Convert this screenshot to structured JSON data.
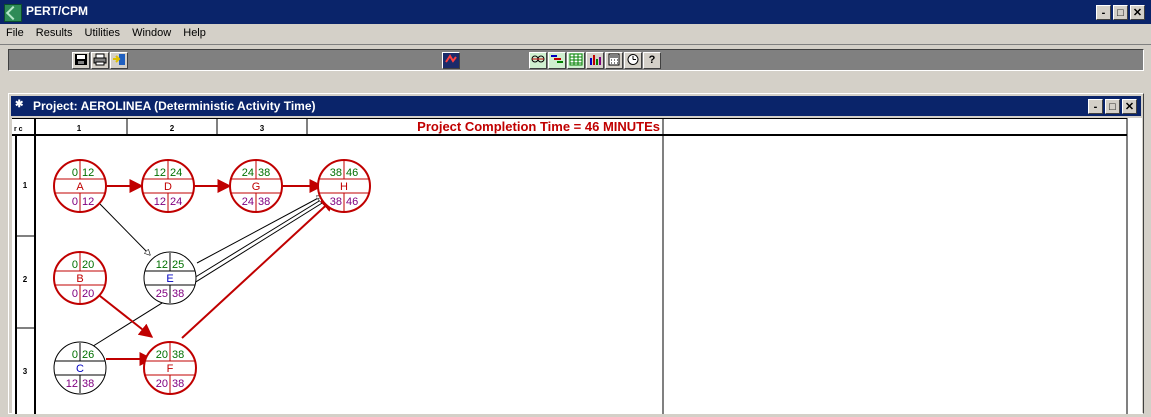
{
  "app": {
    "title": "PERT/CPM"
  },
  "window_controls": {
    "minimize": "-",
    "maximize": "□",
    "close": "✕"
  },
  "menu": [
    "File",
    "Results",
    "Utilities",
    "Window",
    "Help"
  ],
  "toolbar": {
    "icons": [
      "save-icon",
      "print-icon",
      "exit-icon",
      "solve-icon",
      "network-icon",
      "gantt-icon",
      "table-icon",
      "bar-chart-icon",
      "calculator-icon",
      "clock-icon",
      "help-icon"
    ],
    "help_glyph": "?"
  },
  "project_window": {
    "title": "Project: AEROLINEA (Deterministic Activity Time)",
    "corner_label": "r c",
    "col_headers": [
      "1",
      "2",
      "3"
    ],
    "row_headers": [
      "1",
      "2",
      "3"
    ],
    "completion": "Project Completion Time = 46 MINUTEs"
  },
  "activities": [
    {
      "id": "A",
      "es": "0",
      "ef": "12",
      "ls": "0",
      "lf": "12",
      "critical": true
    },
    {
      "id": "D",
      "es": "12",
      "ef": "24",
      "ls": "12",
      "lf": "24",
      "critical": true
    },
    {
      "id": "G",
      "es": "24",
      "ef": "38",
      "ls": "24",
      "lf": "38",
      "critical": true
    },
    {
      "id": "H",
      "es": "38",
      "ef": "46",
      "ls": "38",
      "lf": "46",
      "critical": true
    },
    {
      "id": "B",
      "es": "0",
      "ef": "20",
      "ls": "0",
      "lf": "20",
      "critical": true
    },
    {
      "id": "E",
      "es": "12",
      "ef": "25",
      "ls": "25",
      "lf": "38",
      "critical": false
    },
    {
      "id": "C",
      "es": "0",
      "ef": "26",
      "ls": "12",
      "lf": "38",
      "critical": false
    },
    {
      "id": "F",
      "es": "20",
      "ef": "38",
      "ls": "20",
      "lf": "38",
      "critical": true
    }
  ],
  "colors": {
    "critical": "#c00000",
    "noncritical": "#000000",
    "early_times": "#007000",
    "late_times": "#800080",
    "noncritical_label": "#0000c0",
    "titlebar": "#0a246a"
  }
}
